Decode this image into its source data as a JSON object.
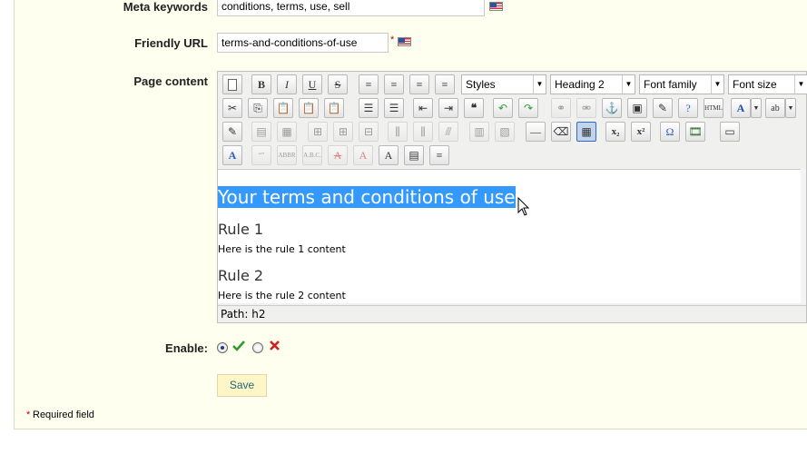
{
  "form": {
    "meta_keywords_label": "Meta keywords",
    "meta_keywords_value": "conditions, terms, use, sell",
    "friendly_url_label": "Friendly URL",
    "friendly_url_value": "terms-and-conditions-of-use",
    "required_star": "*",
    "page_content_label": "Page content",
    "enable_label": "Enable:",
    "enable_value": "yes",
    "save_label": "Save",
    "required_note": "Required field"
  },
  "toolbar": {
    "styles": "Styles",
    "format": "Heading 2",
    "font_family": "Font family",
    "font_size": "Font size",
    "dropdown_arrow": "▼",
    "bold": "B",
    "italic": "I",
    "underline": "U",
    "strike": "S",
    "quote": "❝",
    "subscript": "x₂",
    "superscript": "x²",
    "omega": "Ω",
    "text_color": "A",
    "bg_color": "ab"
  },
  "editor": {
    "heading": "Your terms and conditions of use",
    "rule1_title": "Rule 1",
    "rule1_text": "Here is the rule 1 content",
    "rule2_title": "Rule 2",
    "rule2_text": "Here is the rule 2 content",
    "path": "Path: h2"
  },
  "colors": {
    "panel_bg": "#fffff0",
    "selection": "#3399ff",
    "enabled_check": "#2e9e2e",
    "disabled_cross": "#d02020",
    "save_bg": "#fff6c8"
  }
}
